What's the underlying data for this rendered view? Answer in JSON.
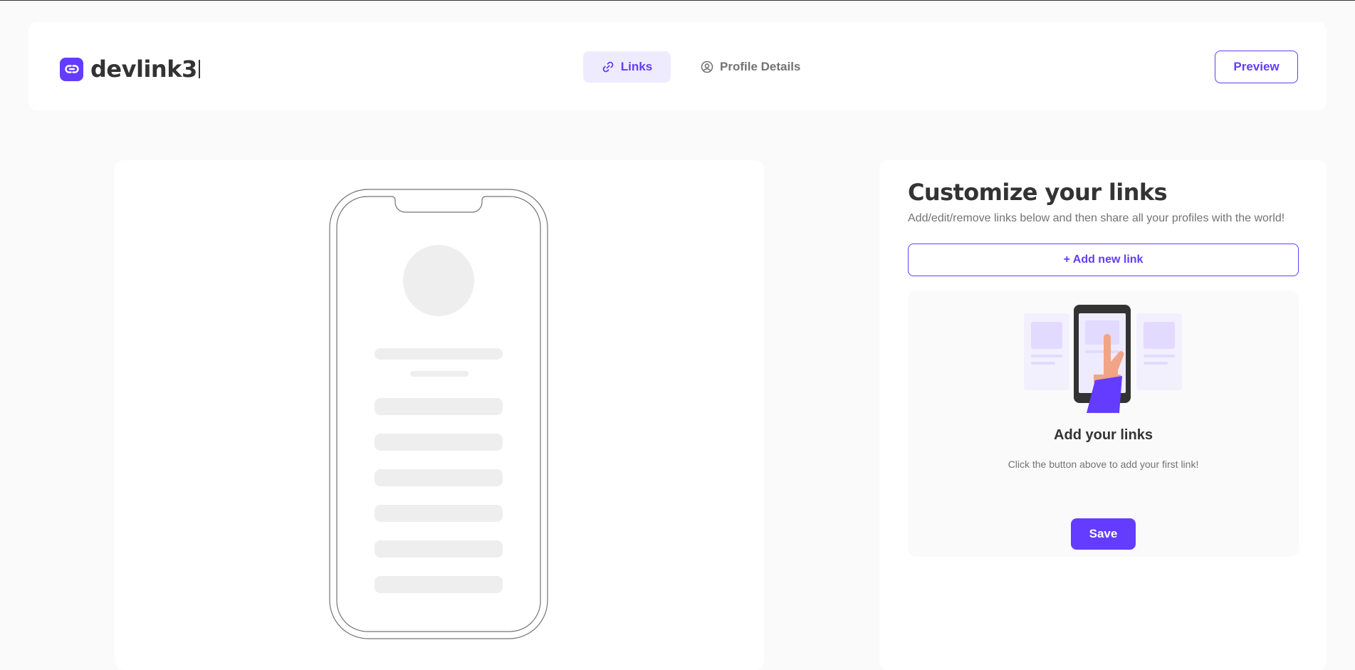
{
  "app": {
    "logo_text": "devlink3"
  },
  "header": {
    "tabs": [
      {
        "label": "Links",
        "icon": "link-icon",
        "active": true
      },
      {
        "label": "Profile Details",
        "icon": "user-circle-icon",
        "active": false
      }
    ],
    "preview_label": "Preview"
  },
  "editor": {
    "title": "Customize your links",
    "subtitle": "Add/edit/remove links below and then share all your profiles with the world!",
    "add_link_label": "+ Add new link",
    "empty_state": {
      "title": "Add your links",
      "text": "Click the button above to add your first link!",
      "illustration_icon": "hand-phone-icon"
    },
    "save_label": "Save"
  },
  "colors": {
    "accent": "#633cff",
    "accent_light": "#efebff",
    "text_dark": "#333333",
    "text_muted": "#737373",
    "background": "#fafafa",
    "skeleton": "#eeeeee"
  }
}
